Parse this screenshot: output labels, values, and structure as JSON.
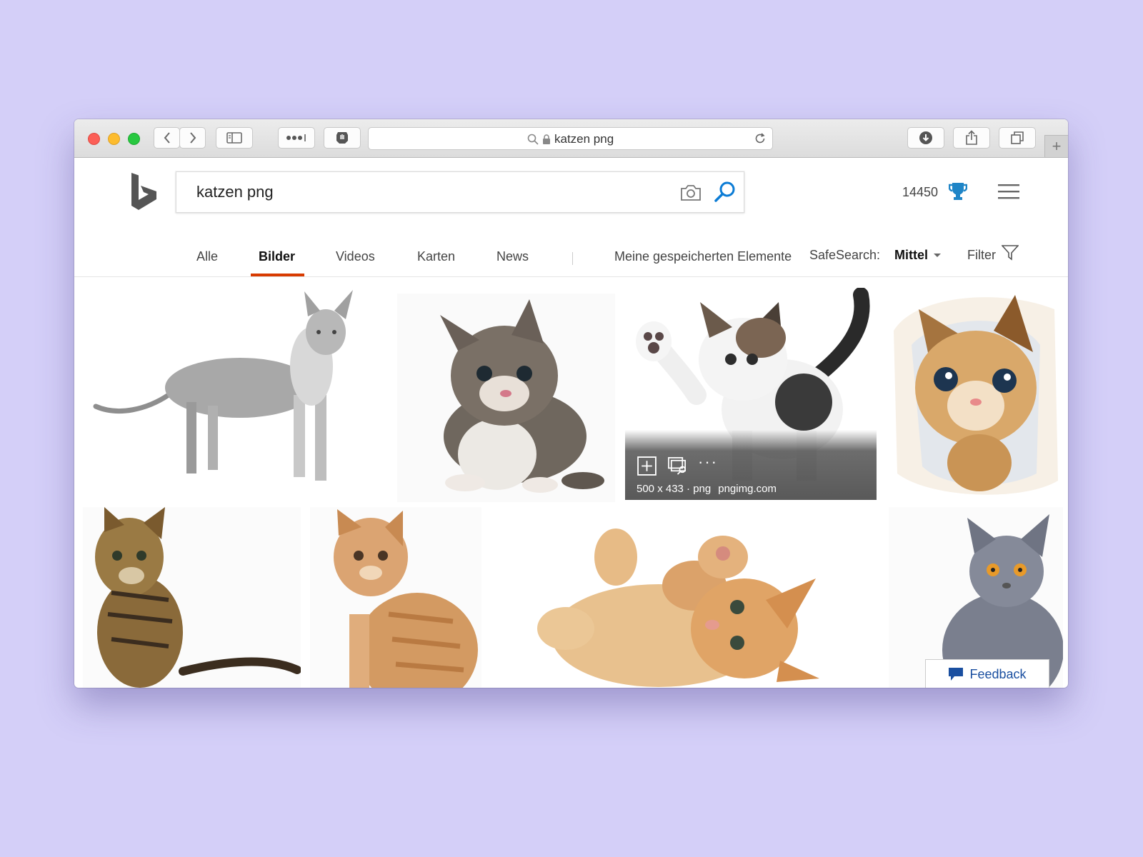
{
  "browser": {
    "address_text": "katzen png",
    "icons": {
      "back": "chevron-left-icon",
      "forward": "chevron-right-icon",
      "sidebar": "sidebar-icon",
      "extensions": "dots-icon",
      "shield": "hand-shield-icon",
      "reload": "reload-icon",
      "download": "download-icon",
      "share": "share-icon",
      "tabs": "tabs-icon",
      "new_tab": "plus-icon"
    }
  },
  "bing": {
    "query": "katzen png",
    "rewards_points": "14450",
    "colors": {
      "accent_underline": "#d83b01",
      "search_icon": "#0c7cd5",
      "trophy": "#1f85c7"
    }
  },
  "scopes": {
    "items": [
      "Alle",
      "Bilder",
      "Videos",
      "Karten",
      "News"
    ],
    "active": "Bilder",
    "saved": "Meine gespeicherten Elemente",
    "safesearch_label": "SafeSearch:",
    "safesearch_value": "Mittel",
    "filter": "Filter"
  },
  "hover_card": {
    "dimensions": "500 x 433 · png",
    "source": "pngimg.com",
    "more": "···"
  },
  "feedback": {
    "label": "Feedback"
  }
}
